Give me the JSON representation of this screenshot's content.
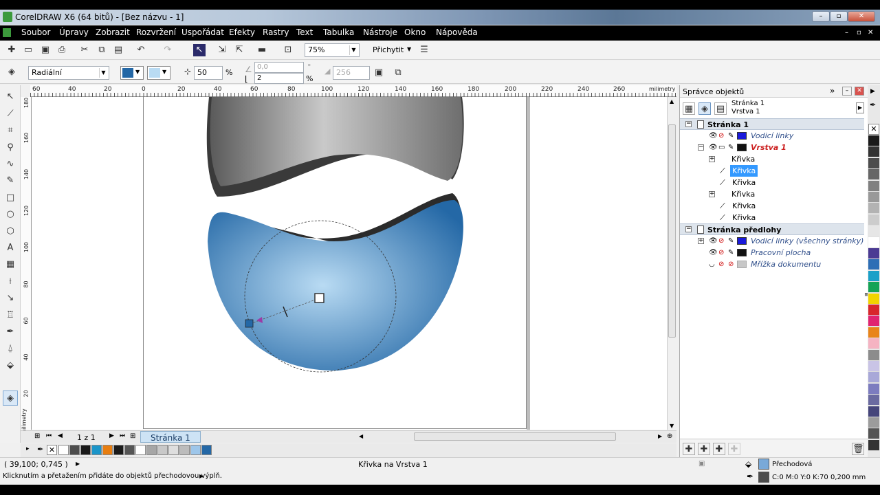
{
  "title": "CorelDRAW X6 (64 bitů) - [Bez názvu - 1]",
  "menu": [
    "Soubor",
    "Úpravy",
    "Zobrazit",
    "Rozvržení",
    "Uspořádat",
    "Efekty",
    "Rastry",
    "Text",
    "Tabulka",
    "Nástroje",
    "Okno",
    "Nápověda"
  ],
  "toolbar": {
    "zoom": "75%",
    "snap_label": "Přichytit"
  },
  "propbar": {
    "fill_type": "Radiální",
    "midpoint": "50",
    "pct": "%",
    "angle": "0,0",
    "steps_edge": "2",
    "deg": "°",
    "pct2": "%",
    "steps": "256"
  },
  "rulers": {
    "h_ticks": [
      "60",
      "40",
      "20",
      "0",
      "20",
      "40",
      "60",
      "80",
      "100",
      "120",
      "140",
      "160",
      "180",
      "200",
      "220",
      "240",
      "260"
    ],
    "h_unit": "milimetry",
    "v_ticks": [
      "180",
      "160",
      "140",
      "120",
      "100",
      "80",
      "60",
      "40",
      "20"
    ],
    "v_unit": "milimetry"
  },
  "pager": {
    "count": "1 z 1",
    "tab": "Stránka 1"
  },
  "docker": {
    "title": "Správce objektů",
    "page_line1": "Stránka 1",
    "page_line2": "Vrstva 1",
    "rows": [
      {
        "label": "Stránka 1",
        "type": "hdr"
      },
      {
        "label": "Vodicí linky",
        "type": "layer",
        "italic": true,
        "color": "#1a1adb"
      },
      {
        "label": "Vrstva 1",
        "type": "layer",
        "red": true,
        "color": "#111111"
      },
      {
        "label": "Křivka",
        "type": "obj",
        "group": true
      },
      {
        "label": "Křivka",
        "type": "obj",
        "selected": true
      },
      {
        "label": "Křivka",
        "type": "obj"
      },
      {
        "label": "Křivka",
        "type": "obj",
        "group": true
      },
      {
        "label": "Křivka",
        "type": "obj"
      },
      {
        "label": "Křivka",
        "type": "obj"
      },
      {
        "label": "Stránka předlohy",
        "type": "hdr"
      },
      {
        "label": "Vodicí linky (všechny stránky)",
        "type": "layer",
        "italic": true,
        "color": "#1a1adb"
      },
      {
        "label": "Pracovní plocha",
        "type": "layer",
        "italic": true,
        "color": "#111111"
      },
      {
        "label": "Mřížka dokumentu",
        "type": "layer",
        "italic": true,
        "color": "#c8c8c8"
      }
    ]
  },
  "status": {
    "coords": "( 39,100; 0,745 )",
    "object": "Křivka na Vrstva 1",
    "hint": "Klicknutím a přetažením přidáte do objektů přechodovou výplň.",
    "fill_label": "Přechodová",
    "outline_label": "C:0 M:0 Y:0 K:70  0,200 mm"
  },
  "colors": {
    "bottom_palette": [
      "#ffffff",
      "#4d4d4d",
      "#1a1a1a",
      "#1b95c9",
      "#e87e10",
      "#1a1a1a",
      "#555555",
      "#ffffff",
      "#a6a6a6",
      "#c8c8c8",
      "#dedede",
      "#bcbcbc",
      "#9dc6ea",
      "#2468a6"
    ],
    "right_palette": [
      "#1a1a1a",
      "#333333",
      "#4d4d4d",
      "#666666",
      "#808080",
      "#999999",
      "#b3b3b3",
      "#cccccc",
      "#e6e6e6",
      "#ffffff",
      "#4b3a93",
      "#2e6eb5",
      "#1aa0c8",
      "#15a356",
      "#f2d400",
      "#d8262c",
      "#e02471",
      "#e8841a",
      "#f5b3c2",
      "#8c8c8c",
      "#c9c4e6",
      "#a8a8d8",
      "#7c7cbf",
      "#6a6aa0",
      "#45457a",
      "#9c9c9c",
      "#555555",
      "#333333"
    ]
  }
}
